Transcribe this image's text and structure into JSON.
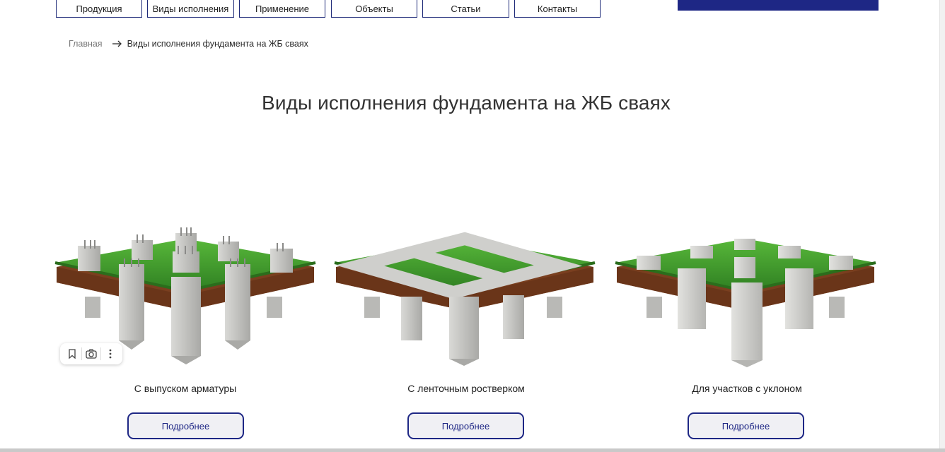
{
  "nav": {
    "items": [
      {
        "label": "Продукция"
      },
      {
        "label": "Виды исполнения"
      },
      {
        "label": "Применение"
      },
      {
        "label": "Объекты"
      },
      {
        "label": "Статьи"
      },
      {
        "label": "Контакты"
      }
    ]
  },
  "breadcrumb": {
    "home": "Главная",
    "current": "Виды исполнения фундамента на ЖБ сваях"
  },
  "page_title": "Виды исполнения фундамента на ЖБ сваях",
  "cards": [
    {
      "label": "С выпуском арматуры",
      "button": "Подробнее"
    },
    {
      "label": "С ленточным ростверком",
      "button": "Подробнее"
    },
    {
      "label": "Для участков с уклоном",
      "button": "Подробнее"
    }
  ],
  "image_toolbar": {
    "icons": [
      "bookmark-icon",
      "lens-search-icon",
      "more-vertical-icon"
    ]
  },
  "colors": {
    "accent": "#1e2785",
    "grass": "#3f9a2c",
    "soil": "#7a3f1f",
    "concrete": "#c9c9c6"
  }
}
